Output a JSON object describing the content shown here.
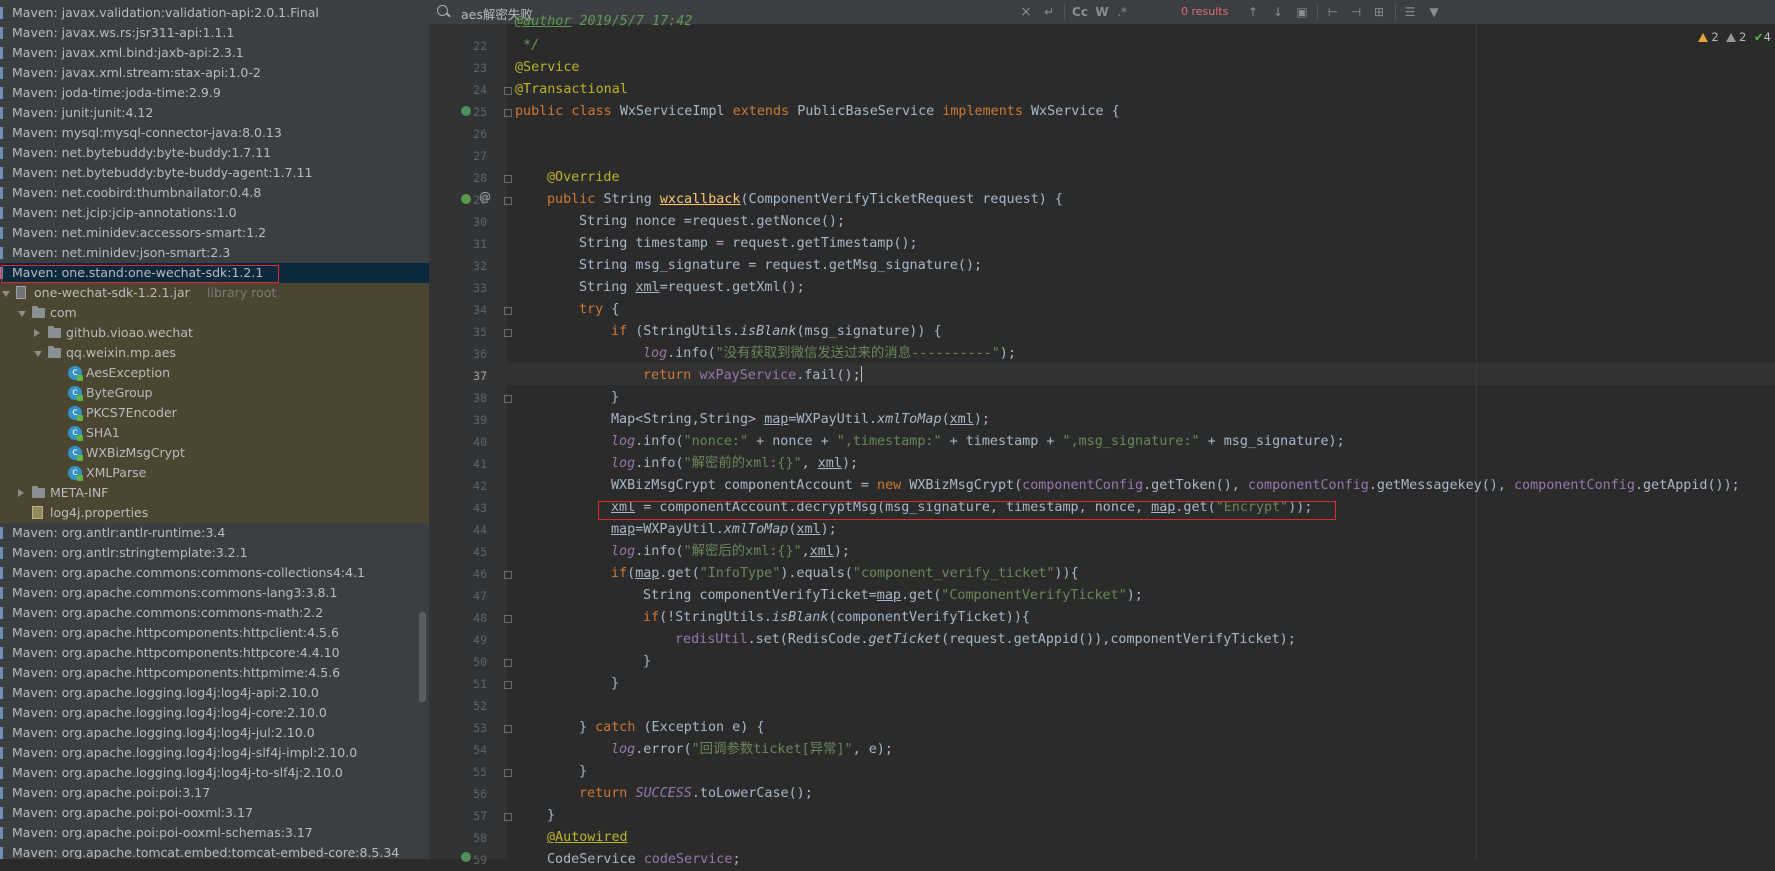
{
  "sidebar": {
    "items": [
      {
        "label": "Maven: javax.validation:validation-api:2.0.1.Final"
      },
      {
        "label": "Maven: javax.ws.rs:jsr311-api:1.1.1"
      },
      {
        "label": "Maven: javax.xml.bind:jaxb-api:2.3.1"
      },
      {
        "label": "Maven: javax.xml.stream:stax-api:1.0-2"
      },
      {
        "label": "Maven: joda-time:joda-time:2.9.9"
      },
      {
        "label": "Maven: junit:junit:4.12"
      },
      {
        "label": "Maven: mysql:mysql-connector-java:8.0.13"
      },
      {
        "label": "Maven: net.bytebuddy:byte-buddy:1.7.11"
      },
      {
        "label": "Maven: net.bytebuddy:byte-buddy-agent:1.7.11"
      },
      {
        "label": "Maven: net.coobird:thumbnailator:0.4.8"
      },
      {
        "label": "Maven: net.jcip:jcip-annotations:1.0"
      },
      {
        "label": "Maven: net.minidev:accessors-smart:1.2"
      },
      {
        "label": "Maven: net.minidev:json-smart:2.3"
      },
      {
        "label": "Maven: one.stand:one-wechat-sdk:1.2.1"
      },
      {
        "label": "one-wechat-sdk-1.2.1.jar",
        "suffix": "library root"
      },
      {
        "label": "com"
      },
      {
        "label": "github.vioao.wechat"
      },
      {
        "label": "qq.weixin.mp.aes"
      },
      {
        "label": "AesException"
      },
      {
        "label": "ByteGroup"
      },
      {
        "label": "PKCS7Encoder"
      },
      {
        "label": "SHA1"
      },
      {
        "label": "WXBizMsgCrypt"
      },
      {
        "label": "XMLParse"
      },
      {
        "label": "META-INF"
      },
      {
        "label": "log4j.properties"
      },
      {
        "label": "Maven: org.antlr:antlr-runtime:3.4"
      },
      {
        "label": "Maven: org.antlr:stringtemplate:3.2.1"
      },
      {
        "label": "Maven: org.apache.commons:commons-collections4:4.1"
      },
      {
        "label": "Maven: org.apache.commons:commons-lang3:3.8.1"
      },
      {
        "label": "Maven: org.apache.commons:commons-math:2.2"
      },
      {
        "label": "Maven: org.apache.httpcomponents:httpclient:4.5.6"
      },
      {
        "label": "Maven: org.apache.httpcomponents:httpcore:4.4.10"
      },
      {
        "label": "Maven: org.apache.httpcomponents:httpmime:4.5.6"
      },
      {
        "label": "Maven: org.apache.logging.log4j:log4j-api:2.10.0"
      },
      {
        "label": "Maven: org.apache.logging.log4j:log4j-core:2.10.0"
      },
      {
        "label": "Maven: org.apache.logging.log4j:log4j-jul:2.10.0"
      },
      {
        "label": "Maven: org.apache.logging.log4j:log4j-slf4j-impl:2.10.0"
      },
      {
        "label": "Maven: org.apache.logging.log4j:log4j-to-slf4j:2.10.0"
      },
      {
        "label": "Maven: org.apache.poi:poi:3.17"
      },
      {
        "label": "Maven: org.apache.poi:poi-ooxml:3.17"
      },
      {
        "label": "Maven: org.apache.poi:poi-ooxml-schemas:3.17"
      },
      {
        "label": "Maven: org.apache.tomcat.embed:tomcat-embed-core:8.5.34"
      }
    ]
  },
  "search": {
    "query": "aes解密失败",
    "results": "0 results",
    "opt_case": "Cc",
    "opt_words": "W",
    "opt_regex": ".*"
  },
  "inspections": {
    "warnings": "2",
    "weak_warnings": "2",
    "ok": "4"
  },
  "code": {
    "line_numbers": [
      "22",
      "23",
      "24",
      "25",
      "26",
      "27",
      "28",
      "29",
      "30",
      "31",
      "32",
      "33",
      "34",
      "35",
      "36",
      "37",
      "38",
      "39",
      "40",
      "41",
      "42",
      "43",
      "44",
      "45",
      "46",
      "47",
      "48",
      "49",
      "50",
      "51",
      "52",
      "53",
      "54",
      "55",
      "56",
      "57",
      "58",
      "59"
    ],
    "l21_a": "@author",
    "l21_b": " 2019/5/7 17:42",
    "l22": " */",
    "l23": "@Service",
    "l24": "@Transactional",
    "l25_kw1": "public class ",
    "l25_cls": "WxServiceImpl ",
    "l25_kw2": "extends ",
    "l25_base": "PublicBaseService ",
    "l25_kw3": "implements ",
    "l25_iface": "WxService {",
    "l28": "@Override",
    "l29_kw": "public ",
    "l29_t": "String ",
    "l29_fn": "wxcallback",
    "l29_rest": "(ComponentVerifyTicketRequest request) {",
    "l30": "String nonce =request.getNonce();",
    "l31": "String timestamp = request.getTimestamp();",
    "l32": "String msg_signature = request.getMsg_signature();",
    "l33_a": "String ",
    "l33_b": "xml",
    "l33_c": "=request.getXml();",
    "l34_kw": "try",
    "l34_rest": " {",
    "l35_kw": "if ",
    "l35_a": "(StringUtils.",
    "l35_b": "isBlank",
    "l35_c": "(msg_signature)) {",
    "l36_a": "log",
    "l36_b": ".info(",
    "l36_str": "\"没有获取到微信发送过来的消息----------\"",
    "l36_c": ");",
    "l37_kw": "return ",
    "l37_fld": "wxPayService",
    "l37_rest": ".fail();",
    "l38": "}",
    "l39_a": "Map<String,String> ",
    "l39_b": "map",
    "l39_c": "=WXPayUtil.",
    "l39_d": "xmlToMap",
    "l39_e": "(",
    "l39_f": "xml",
    "l39_g": ");",
    "l40_a": "log",
    "l40_b": ".info(",
    "l40_s1": "\"nonce:\"",
    "l40_c": " + nonce + ",
    "l40_s2": "\",timestamp:\"",
    "l40_d": " + timestamp + ",
    "l40_s3": "\",msg_signature:\"",
    "l40_e": " + msg_signature);",
    "l41_a": "log",
    "l41_b": ".info(",
    "l41_s": "\"解密前的xml:{}\"",
    "l41_c": ", ",
    "l41_d": "xml",
    "l41_e": ");",
    "l42_a": "WXBizMsgCrypt componentAccount = ",
    "l42_kw": "new ",
    "l42_b": "WXBizMsgCrypt(",
    "l42_f1": "componentConfig",
    "l42_c": ".getToken(), ",
    "l42_f2": "componentConfig",
    "l42_d": ".getMessagekey(), ",
    "l42_f3": "componentConfig",
    "l42_e": ".getAppid());",
    "l43_a": "xml",
    "l43_b": " = componentAccount.decryptMsg(msg_signature, timestamp, nonce, ",
    "l43_c": "map",
    "l43_d": ".get(",
    "l43_s": "\"Encrypt\"",
    "l43_e": "));",
    "l44_a": "map",
    "l44_b": "=WXPayUtil.",
    "l44_c": "xmlToMap",
    "l44_d": "(",
    "l44_e": "xml",
    "l44_f": ");",
    "l45_a": "log",
    "l45_b": ".info(",
    "l45_s": "\"解密后的xml:{}\"",
    "l45_c": ",",
    "l45_d": "xml",
    "l45_e": ");",
    "l46_kw": "if",
    "l46_a": "(",
    "l46_b": "map",
    "l46_c": ".get(",
    "l46_s1": "\"InfoType\"",
    "l46_d": ").equals(",
    "l46_s2": "\"component_verify_ticket\"",
    "l46_e": ")){",
    "l47_a": "String componentVerifyTicket=",
    "l47_b": "map",
    "l47_c": ".get(",
    "l47_s": "\"ComponentVerifyTicket\"",
    "l47_d": ");",
    "l48_kw": "if",
    "l48_a": "(!StringUtils.",
    "l48_b": "isBlank",
    "l48_c": "(componentVerifyTicket)){",
    "l49_f": "redisUtil",
    "l49_a": ".set(RedisCode.",
    "l49_b": "getTicket",
    "l49_c": "(request.getAppid()),componentVerifyTicket);",
    "l50": "}",
    "l51": "}",
    "l53_a": "} ",
    "l53_kw": "catch ",
    "l53_b": "(Exception e) {",
    "l54_a": "log",
    "l54_b": ".error(",
    "l54_s": "\"回调参数ticket[异常]\"",
    "l54_c": ", e);",
    "l55": "}",
    "l56_kw": "return ",
    "l56_a": "SUCCESS",
    "l56_b": ".toLowerCase();",
    "l57": "}",
    "l58": "@Autowired",
    "l59_a": "CodeService ",
    "l59_b": "codeService",
    "l59_c": ";"
  }
}
